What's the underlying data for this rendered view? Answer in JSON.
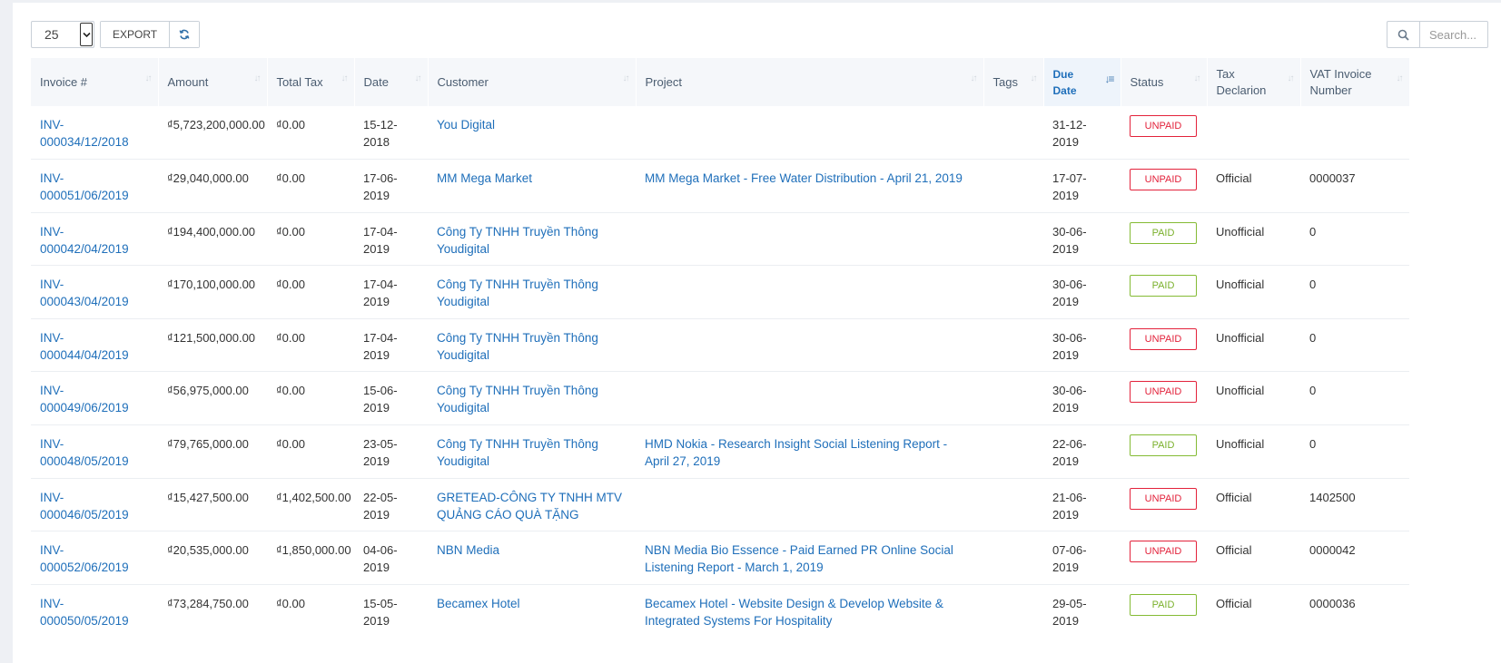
{
  "toolbar": {
    "page_length": "25",
    "export_label": "EXPORT"
  },
  "search": {
    "placeholder": "Search..."
  },
  "columns": {
    "invoice": "Invoice #",
    "amount": "Amount",
    "total_tax": "Total Tax",
    "date": "Date",
    "customer": "Customer",
    "project": "Project",
    "tags": "Tags",
    "due_date": "Due Date",
    "status": "Status",
    "tax_declaration": "Tax Declarion",
    "vat_invoice_number": "VAT Invoice Number"
  },
  "colors": {
    "link": "#1f6fba",
    "unpaid": "#e3223b",
    "paid": "#7ab02b"
  },
  "rows": [
    {
      "invoice": "INV-000034/12/2018",
      "amount": "₫5,723,200,000.00",
      "tax": "₫0.00",
      "date": "15-12-2018",
      "customer": "You Digital",
      "project": "",
      "tags": "",
      "due": "31-12-2019",
      "status": "UNPAID",
      "declaration": "",
      "vat": ""
    },
    {
      "invoice": "INV-000051/06/2019",
      "amount": "₫29,040,000.00",
      "tax": "₫0.00",
      "date": "17-06-2019",
      "customer": "MM Mega Market",
      "project": "MM Mega Market - Free Water Distribution - April 21, 2019",
      "tags": "",
      "due": "17-07-2019",
      "status": "UNPAID",
      "declaration": "Official",
      "vat": "0000037"
    },
    {
      "invoice": "INV-000042/04/2019",
      "amount": "₫194,400,000.00",
      "tax": "₫0.00",
      "date": "17-04-2019",
      "customer": "Công Ty TNHH Truyền Thông Youdigital",
      "project": "",
      "tags": "",
      "due": "30-06-2019",
      "status": "PAID",
      "declaration": "Unofficial",
      "vat": "0"
    },
    {
      "invoice": "INV-000043/04/2019",
      "amount": "₫170,100,000.00",
      "tax": "₫0.00",
      "date": "17-04-2019",
      "customer": "Công Ty TNHH Truyền Thông Youdigital",
      "project": "",
      "tags": "",
      "due": "30-06-2019",
      "status": "PAID",
      "declaration": "Unofficial",
      "vat": "0"
    },
    {
      "invoice": "INV-000044/04/2019",
      "amount": "₫121,500,000.00",
      "tax": "₫0.00",
      "date": "17-04-2019",
      "customer": "Công Ty TNHH Truyền Thông Youdigital",
      "project": "",
      "tags": "",
      "due": "30-06-2019",
      "status": "UNPAID",
      "declaration": "Unofficial",
      "vat": "0"
    },
    {
      "invoice": "INV-000049/06/2019",
      "amount": "₫56,975,000.00",
      "tax": "₫0.00",
      "date": "15-06-2019",
      "customer": "Công Ty TNHH Truyền Thông Youdigital",
      "project": "",
      "tags": "",
      "due": "30-06-2019",
      "status": "UNPAID",
      "declaration": "Unofficial",
      "vat": "0"
    },
    {
      "invoice": "INV-000048/05/2019",
      "amount": "₫79,765,000.00",
      "tax": "₫0.00",
      "date": "23-05-2019",
      "customer": "Công Ty TNHH Truyền Thông Youdigital",
      "project": "HMD Nokia - Research Insight Social Listening Report - April 27, 2019",
      "tags": "",
      "due": "22-06-2019",
      "status": "PAID",
      "declaration": "Unofficial",
      "vat": "0"
    },
    {
      "invoice": "INV-000046/05/2019",
      "amount": "₫15,427,500.00",
      "tax": "₫1,402,500.00",
      "date": "22-05-2019",
      "customer": "GRETEAD-CÔNG TY TNHH MTV QUẢNG CÁO QUÀ TẶNG",
      "project": "",
      "tags": "",
      "due": "21-06-2019",
      "status": "UNPAID",
      "declaration": "Official",
      "vat": "1402500"
    },
    {
      "invoice": "INV-000052/06/2019",
      "amount": "₫20,535,000.00",
      "tax": "₫1,850,000.00",
      "date": "04-06-2019",
      "customer": "NBN Media",
      "project": "NBN Media Bio Essence - Paid Earned PR Online Social Listening Report - March 1, 2019",
      "tags": "",
      "due": "07-06-2019",
      "status": "UNPAID",
      "declaration": "Official",
      "vat": "0000042"
    },
    {
      "invoice": "INV-000050/05/2019",
      "amount": "₫73,284,750.00",
      "tax": "₫0.00",
      "date": "15-05-2019",
      "customer": "Becamex Hotel",
      "project": "Becamex Hotel - Website Design & Develop Website & Integrated Systems For Hospitality",
      "tags": "",
      "due": "29-05-2019",
      "status": "PAID",
      "declaration": "Official",
      "vat": "0000036"
    }
  ]
}
